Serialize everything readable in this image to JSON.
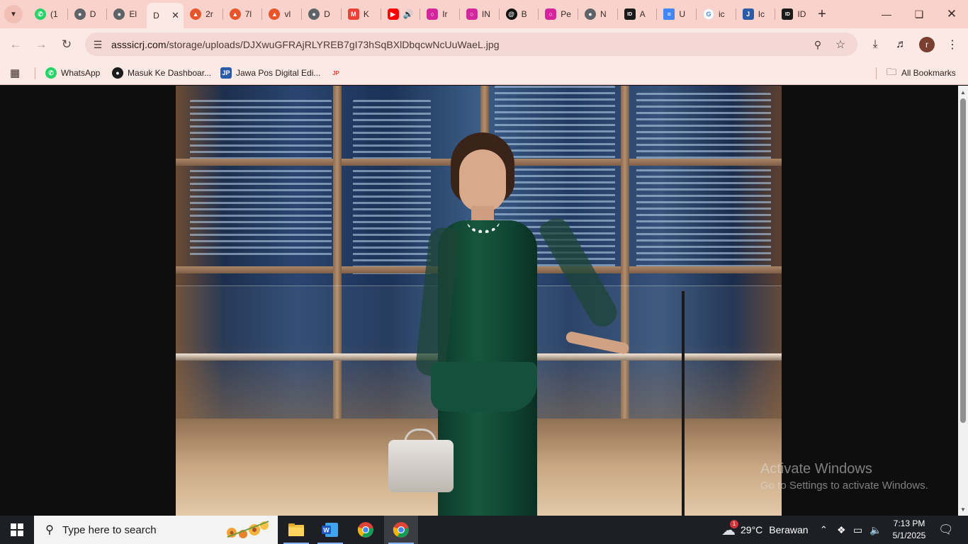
{
  "browser": {
    "tabs": [
      {
        "title": "(1",
        "icon": "whatsapp-icon",
        "color": "#25d366"
      },
      {
        "title": "D",
        "icon": "globe-icon",
        "color": "#5f6368"
      },
      {
        "title": "El",
        "icon": "globe-icon",
        "color": "#5f6368"
      },
      {
        "title": "D",
        "icon": "globe-icon",
        "color": "#5f6368",
        "active": true
      },
      {
        "title": "2r",
        "icon": "fire-icon",
        "color": "#e8542c"
      },
      {
        "title": "7l",
        "icon": "fire-icon",
        "color": "#e8542c"
      },
      {
        "title": "vl",
        "icon": "fire-icon",
        "color": "#e8542c"
      },
      {
        "title": "D",
        "icon": "globe-icon",
        "color": "#5f6368"
      },
      {
        "title": "K",
        "icon": "gmail-icon",
        "color": "#ea4335"
      },
      {
        "title": "",
        "icon": "youtube-icon",
        "color": "#ff0000",
        "audio": true
      },
      {
        "title": "Ir",
        "icon": "instagram-icon",
        "color": "#d6249f"
      },
      {
        "title": "IN",
        "icon": "instagram-icon",
        "color": "#d6249f"
      },
      {
        "title": "B",
        "icon": "threads-icon",
        "color": "#111111"
      },
      {
        "title": "Pe",
        "icon": "instagram-icon",
        "color": "#d6249f"
      },
      {
        "title": "N",
        "icon": "globe-icon",
        "color": "#5f6368"
      },
      {
        "title": "A",
        "icon": "id-icon",
        "color": "#1a1a1a"
      },
      {
        "title": "U",
        "icon": "docs-icon",
        "color": "#4285f4"
      },
      {
        "title": "ic",
        "icon": "google-icon",
        "color": "#4285f4"
      },
      {
        "title": "Ic",
        "icon": "jp-icon",
        "color": "#2b5ba8"
      },
      {
        "title": "ID",
        "icon": "id-icon",
        "color": "#1a1a1a"
      }
    ],
    "url_domain": "asssicrj.com",
    "url_path": "/storage/uploads/DJXwuGFRAjRLYREB7gI73hSqBXlDbqcwNcUuWaeL.jpg",
    "bookmarks": [
      {
        "label": "WhatsApp",
        "icon": "whatsapp-icon"
      },
      {
        "label": "Masuk Ke Dashboar...",
        "icon": "globe-icon"
      },
      {
        "label": "Jawa Pos Digital Edi...",
        "icon": "jp-icon"
      },
      {
        "label": "",
        "icon": "jp-small-icon"
      }
    ],
    "all_bookmarks_label": "All Bookmarks",
    "profile_initial": "r"
  },
  "watermark": {
    "title": "Activate Windows",
    "subtitle": "Go to Settings to activate Windows."
  },
  "taskbar": {
    "search_placeholder": "Type here to search",
    "weather_temp": "29°C",
    "weather_desc": "Berawan",
    "weather_badge": "1",
    "time": "7:13 PM",
    "date": "5/1/2025"
  },
  "colors": {
    "tabstrip": "#f8d2cb",
    "toolbar": "#fbe9e6",
    "taskbar": "#1d1f24"
  }
}
